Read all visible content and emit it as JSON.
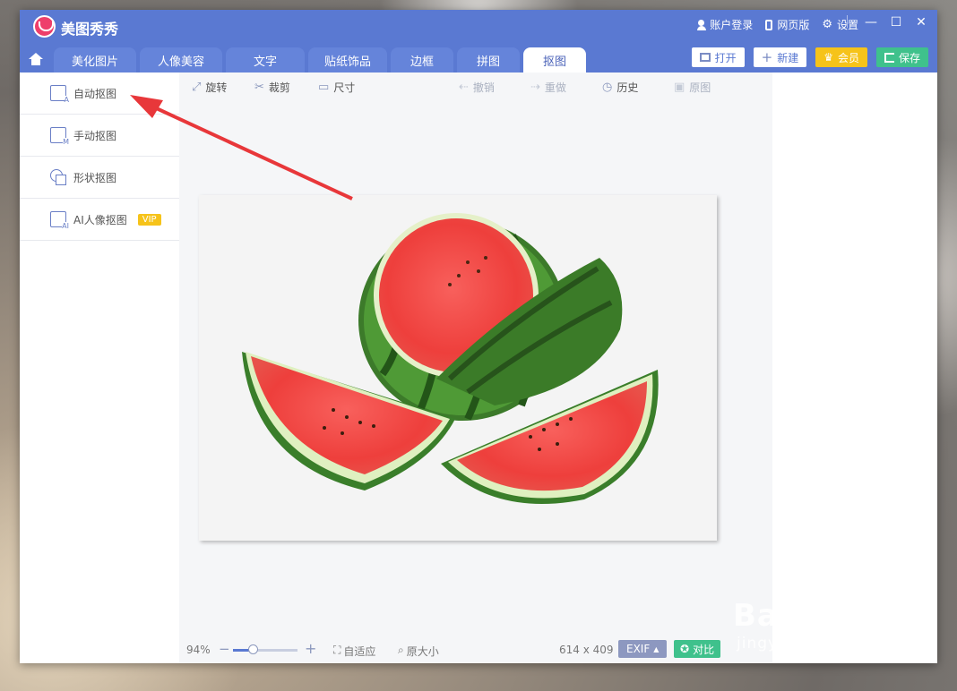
{
  "app": {
    "title": "美图秀秀"
  },
  "top_links": [
    {
      "label": "账户登录",
      "icon": "user-icon"
    },
    {
      "label": "网页版",
      "icon": "phone-icon"
    },
    {
      "label": "设置",
      "icon": "gear-icon"
    }
  ],
  "tabs": [
    "美化图片",
    "人像美容",
    "文字",
    "贴纸饰品",
    "边框",
    "拼图",
    "抠图"
  ],
  "active_tab": "抠图",
  "toolbar_buttons": {
    "open": "打开",
    "new": "新建",
    "vip": "会员",
    "save": "保存"
  },
  "sidebar": {
    "items": [
      {
        "label": "自动抠图",
        "icon": "auto-cutout-icon",
        "letter": "A"
      },
      {
        "label": "手动抠图",
        "icon": "manual-cutout-icon",
        "letter": "M"
      },
      {
        "label": "形状抠图",
        "icon": "shape-cutout-icon",
        "letter": ""
      },
      {
        "label": "AI人像抠图",
        "icon": "ai-portrait-cutout-icon",
        "letter": "AI",
        "badge": "VIP"
      }
    ]
  },
  "edit_bar": {
    "rotate": "旋转",
    "crop": "裁剪",
    "size": "尺寸",
    "undo": "撤销",
    "redo": "重做",
    "history": "历史",
    "original": "原图"
  },
  "status": {
    "zoom": "94%",
    "zoom_level": 0.3,
    "fit": "自适应",
    "actual_size": "原大小",
    "dimensions": "614 x 409",
    "exif": "EXIF",
    "compare": "对比"
  },
  "watermark": {
    "main": "Baidu经验",
    "sub": "jingyan.baidu.com"
  },
  "colors": {
    "titlebar": "#5a79d2",
    "vip_gold": "#f6c31a",
    "save_green": "#3fc18c",
    "arrow_red": "#e8373a"
  }
}
